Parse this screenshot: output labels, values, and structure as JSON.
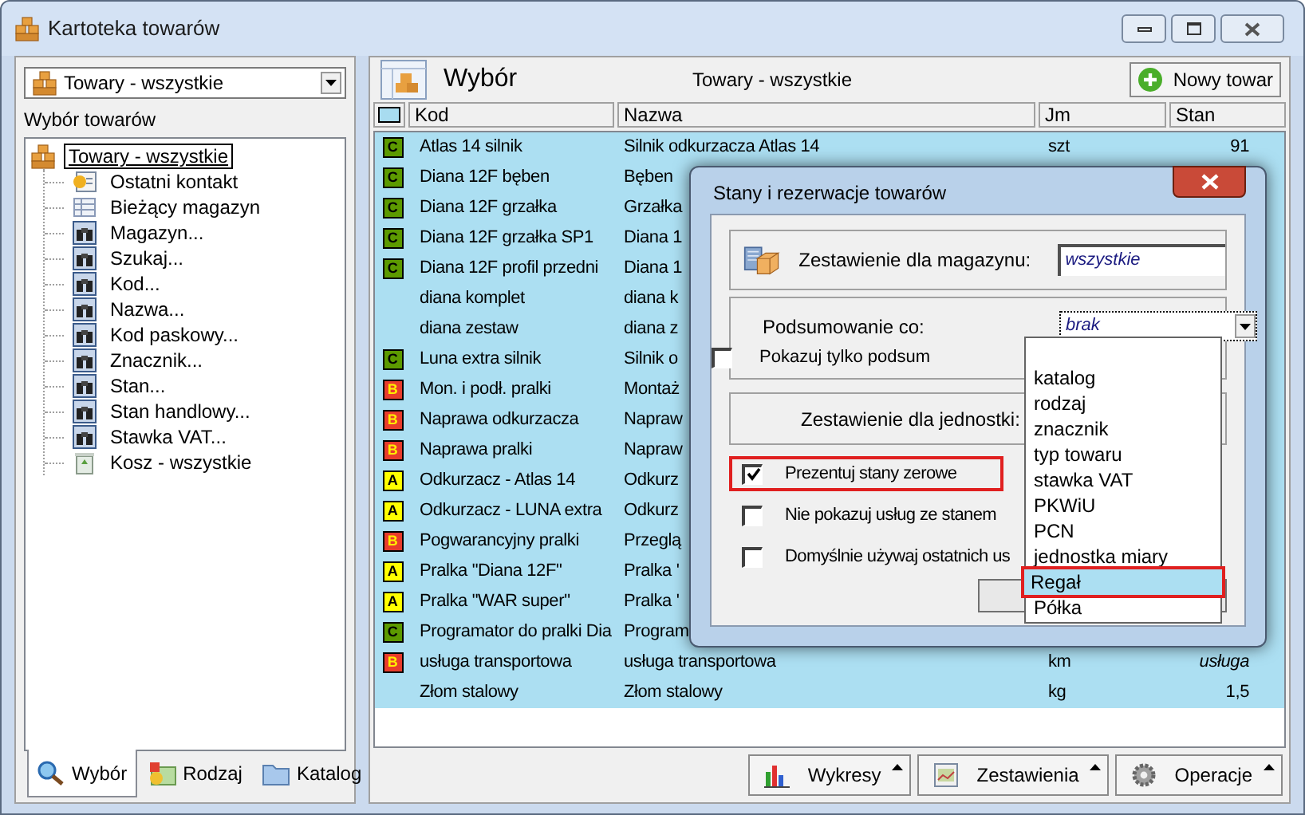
{
  "window": {
    "title": "Kartoteka towarów"
  },
  "sidebar": {
    "selector": {
      "value": "Towary - wszystkie"
    },
    "label": "Wybór towarów",
    "tree": [
      {
        "label": "Towary - wszystkie",
        "kind": "boxes",
        "selected": true,
        "children": [
          {
            "label": "Ostatni kontakt",
            "kind": "contact",
            "selected": false
          },
          {
            "label": "Bieżący magazyn",
            "kind": "grid",
            "selected": false
          },
          {
            "label": "Magazyn...",
            "kind": "binoculars",
            "selected": false
          },
          {
            "label": "Szukaj...",
            "kind": "binoculars",
            "selected": false
          },
          {
            "label": "Kod...",
            "kind": "binoculars",
            "selected": false
          },
          {
            "label": "Nazwa...",
            "kind": "binoculars",
            "selected": false
          },
          {
            "label": "Kod paskowy...",
            "kind": "binoculars",
            "selected": false
          },
          {
            "label": "Znacznik...",
            "kind": "binoculars",
            "selected": false
          },
          {
            "label": "Stan...",
            "kind": "binoculars",
            "selected": false
          },
          {
            "label": "Stan handlowy...",
            "kind": "binoculars",
            "selected": false
          },
          {
            "label": "Stawka VAT...",
            "kind": "binoculars",
            "selected": false
          },
          {
            "label": "Kosz - wszystkie",
            "kind": "trash",
            "selected": false
          }
        ]
      }
    ],
    "tabs": [
      {
        "label": "Wybór",
        "kind": "search",
        "selected": true
      },
      {
        "label": "Rodzaj",
        "kind": "folder-color",
        "selected": false
      },
      {
        "label": "Katalog",
        "kind": "folder",
        "selected": false
      }
    ]
  },
  "main": {
    "title": "Wybór",
    "subtitle": "Towary - wszystkie",
    "new_button": "Nowy towar",
    "table": {
      "columns": [
        "Kod",
        "Nazwa",
        "Jm",
        "Stan"
      ],
      "rows": [
        {
          "badge": {
            "text": "C",
            "color": "#5c9a00"
          },
          "kod": "Atlas 14 silnik",
          "nazwa": "Silnik odkurzacza Atlas 14",
          "jm": "szt",
          "stan": "91",
          "stan_italic": false
        },
        {
          "badge": {
            "text": "C",
            "color": "#5c9a00"
          },
          "kod": "Diana 12F bęben",
          "nazwa": "Bęben"
        },
        {
          "badge": {
            "text": "C",
            "color": "#5c9a00"
          },
          "kod": "Diana 12F grzałka",
          "nazwa": "Grzałka"
        },
        {
          "badge": {
            "text": "C",
            "color": "#5c9a00"
          },
          "kod": "Diana 12F grzałka SP1",
          "nazwa": "Diana 1"
        },
        {
          "badge": {
            "text": "C",
            "color": "#5c9a00"
          },
          "kod": "Diana 12F profil przedni",
          "nazwa": "Diana 1"
        },
        {
          "kod": "diana komplet",
          "nazwa": "diana k"
        },
        {
          "kod": "diana zestaw",
          "nazwa": "diana z"
        },
        {
          "badge": {
            "text": "C",
            "color": "#5c9a00"
          },
          "kod": "Luna extra silnik",
          "nazwa": "Silnik o"
        },
        {
          "badge": {
            "text": "B",
            "color": "#e83c2c"
          },
          "kod": "Mon. i podł. pralki",
          "nazwa": "Montaż"
        },
        {
          "badge": {
            "text": "B",
            "color": "#e83c2c"
          },
          "kod": "Naprawa odkurzacza",
          "nazwa": "Napraw"
        },
        {
          "badge": {
            "text": "B",
            "color": "#e83c2c"
          },
          "kod": "Naprawa pralki",
          "nazwa": "Napraw"
        },
        {
          "badge": {
            "text": "A",
            "color": "#ffff00"
          },
          "kod": "Odkurzacz - Atlas 14",
          "nazwa": "Odkurz"
        },
        {
          "badge": {
            "text": "A",
            "color": "#ffff00"
          },
          "kod": "Odkurzacz - LUNA extra",
          "nazwa": "Odkurz"
        },
        {
          "badge": {
            "text": "B",
            "color": "#e83c2c"
          },
          "kod": "Pogwarancyjny pralki",
          "nazwa": "Przeglą"
        },
        {
          "badge": {
            "text": "A",
            "color": "#ffff00"
          },
          "kod": "Pralka \"Diana 12F\"",
          "nazwa": "Pralka '"
        },
        {
          "badge": {
            "text": "A",
            "color": "#ffff00"
          },
          "kod": "Pralka \"WAR super\"",
          "nazwa": "Pralka '"
        },
        {
          "badge": {
            "text": "C",
            "color": "#5c9a00"
          },
          "kod": "Programator do pralki Dia",
          "nazwa": "Program"
        },
        {
          "badge": {
            "text": "B",
            "color": "#e83c2c"
          },
          "kod": "usługa transportowa",
          "nazwa": "usługa transportowa",
          "jm": "km",
          "stan": "usługa",
          "stan_italic": true
        },
        {
          "kod": "Złom stalowy",
          "nazwa": "Złom stalowy",
          "jm": "kg",
          "stan": "1,5",
          "stan_italic": false
        }
      ]
    },
    "toolbar": [
      {
        "label": "Wykresy",
        "kind": "chart"
      },
      {
        "label": "Zestawienia",
        "kind": "report"
      },
      {
        "label": "Operacje",
        "kind": "gear"
      }
    ]
  },
  "dialog": {
    "title": "Stany i rezerwacje towarów",
    "warehouse": {
      "label": "Zestawienie dla magazynu:",
      "value": "wszystkie"
    },
    "summary": {
      "label": "Podsumowanie co:",
      "value": "brak",
      "only_summary": {
        "label": "Pokazuj tylko podsum",
        "checked": false
      }
    },
    "unit": {
      "label": "Zestawienie dla jednostki:"
    },
    "checkboxes": [
      {
        "label": "Prezentuj stany zerowe",
        "checked": true,
        "highlighted": true
      },
      {
        "label": "Nie pokazuj usług ze stanem",
        "checked": false,
        "highlighted": false
      },
      {
        "label": "Domyślnie używaj ostatnich us",
        "checked": false,
        "highlighted": false
      }
    ],
    "dropdown": {
      "options": [
        {
          "label": "katalog",
          "selected": false
        },
        {
          "label": "rodzaj",
          "selected": false
        },
        {
          "label": "znacznik",
          "selected": false
        },
        {
          "label": "typ towaru",
          "selected": false
        },
        {
          "label": "stawka VAT",
          "selected": false
        },
        {
          "label": "PKWiU",
          "selected": false
        },
        {
          "label": "PCN",
          "selected": false
        },
        {
          "label": "jednostka miary",
          "selected": false
        },
        {
          "label": "Regał",
          "selected": true
        },
        {
          "label": "Półka",
          "selected": false
        }
      ]
    }
  }
}
